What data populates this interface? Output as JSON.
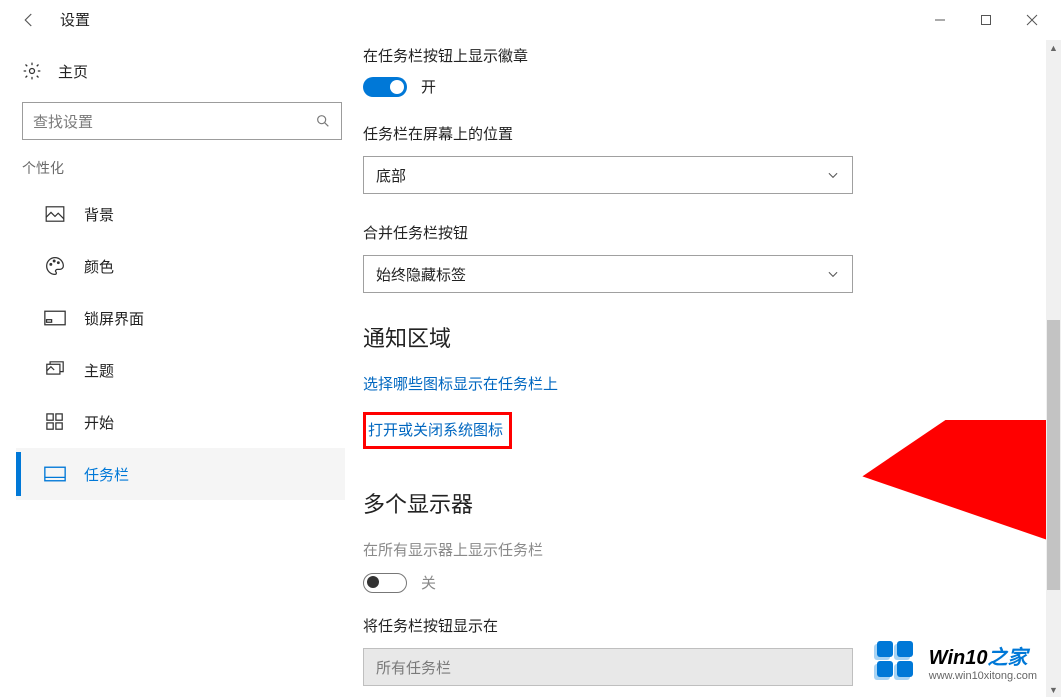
{
  "titlebar": {
    "title": "设置"
  },
  "home": {
    "label": "主页"
  },
  "search": {
    "placeholder": "查找设置"
  },
  "section": "个性化",
  "nav": [
    {
      "label": "背景"
    },
    {
      "label": "颜色"
    },
    {
      "label": "锁屏界面"
    },
    {
      "label": "主题"
    },
    {
      "label": "开始"
    },
    {
      "label": "任务栏"
    }
  ],
  "main": {
    "truncated_heading": "在任务栏按钮上显示徽章",
    "toggle1": {
      "label": "开"
    },
    "pos_label": "任务栏在屏幕上的位置",
    "pos_value": "底部",
    "combine_label": "合并任务栏按钮",
    "combine_value": "始终隐藏标签",
    "notif_heading": "通知区域",
    "link1": "选择哪些图标显示在任务栏上",
    "link2": "打开或关闭系统图标",
    "multi_heading": "多个显示器",
    "multi_toggle_label": "在所有显示器上显示任务栏",
    "multi_toggle_state": "关",
    "show_on_label": "将任务栏按钮显示在",
    "show_on_value": "所有任务栏"
  },
  "watermark": {
    "brand_a": "Win10",
    "brand_b": "之家",
    "url": "www.win10xitong.com"
  }
}
